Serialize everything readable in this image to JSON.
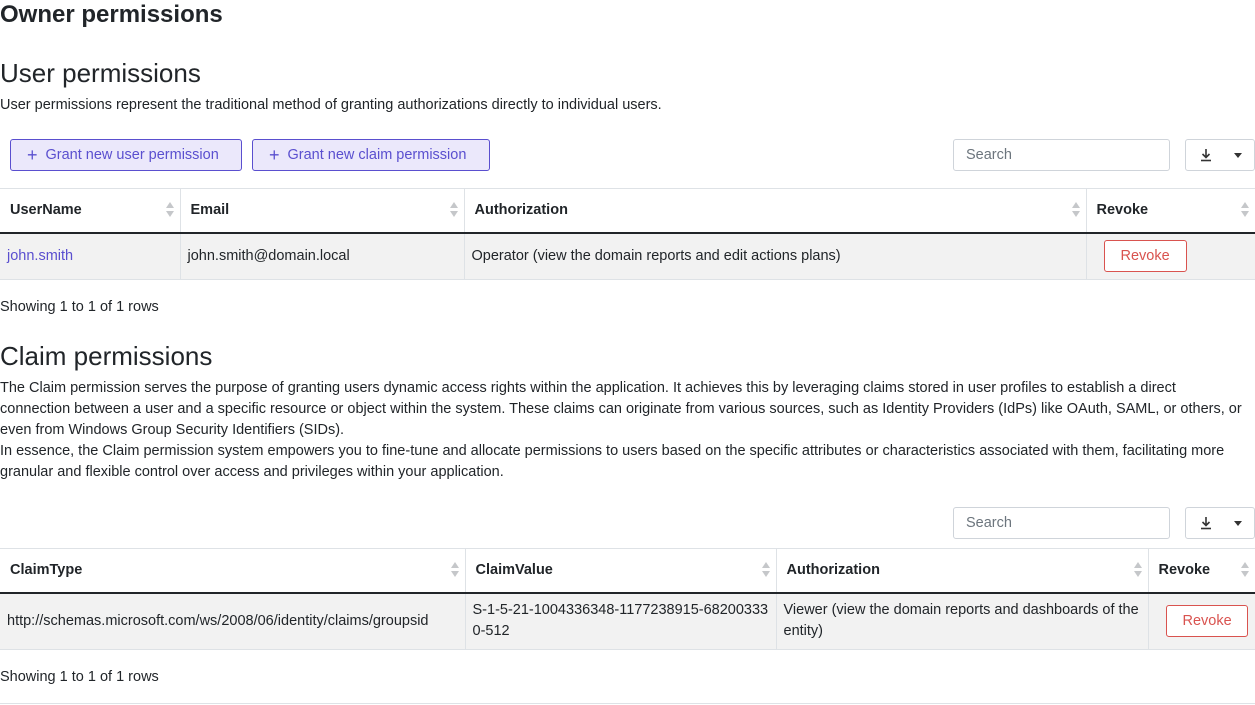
{
  "page": {
    "title": "Owner permissions"
  },
  "user_permissions": {
    "heading": "User permissions",
    "description": "User permissions represent the traditional method of granting authorizations directly to individual users.",
    "grant_user_label": "Grant new user permission",
    "grant_claim_label": "Grant new claim permission",
    "search_placeholder": "Search",
    "columns": [
      "UserName",
      "Email",
      "Authorization",
      "Revoke"
    ],
    "rows": [
      {
        "username": "john.smith",
        "email": "john.smith@domain.local",
        "authorization": "Operator (view the domain reports and edit actions plans)",
        "revoke_label": "Revoke"
      }
    ],
    "footer": "Showing 1 to 1 of 1 rows"
  },
  "claim_permissions": {
    "heading": "Claim permissions",
    "description_1": "The Claim permission serves the purpose of granting users dynamic access rights within the application. It achieves this by leveraging claims stored in user profiles to establish a direct connection between a user and a specific resource or object within the system. These claims can originate from various sources, such as Identity Providers (IdPs) like OAuth, SAML, or others, or even from Windows Group Security Identifiers (SIDs).",
    "description_2": "In essence, the Claim permission system empowers you to fine-tune and allocate permissions to users based on the specific attributes or characteristics associated with them, facilitating more granular and flexible control over access and privileges within your application.",
    "search_placeholder": "Search",
    "columns": [
      "ClaimType",
      "ClaimValue",
      "Authorization",
      "Revoke"
    ],
    "rows": [
      {
        "claim_type": "http://schemas.microsoft.com/ws/2008/06/identity/claims/groupsid",
        "claim_value": "S-1-5-21-1004336348-1177238915-682003330-512",
        "authorization": "Viewer (view the domain reports and dashboards of the entity)",
        "revoke_label": "Revoke"
      }
    ],
    "footer": "Showing 1 to 1 of 1 rows"
  },
  "icons": {
    "plus": "plus-icon",
    "download": "download-icon",
    "caret": "caret-down-icon",
    "sort": "sort-icon"
  },
  "colors": {
    "accent": "#5a4fcf",
    "accent_bg": "#ebe8fb",
    "danger": "#d9534f",
    "row_bg": "#f2f2f2"
  }
}
